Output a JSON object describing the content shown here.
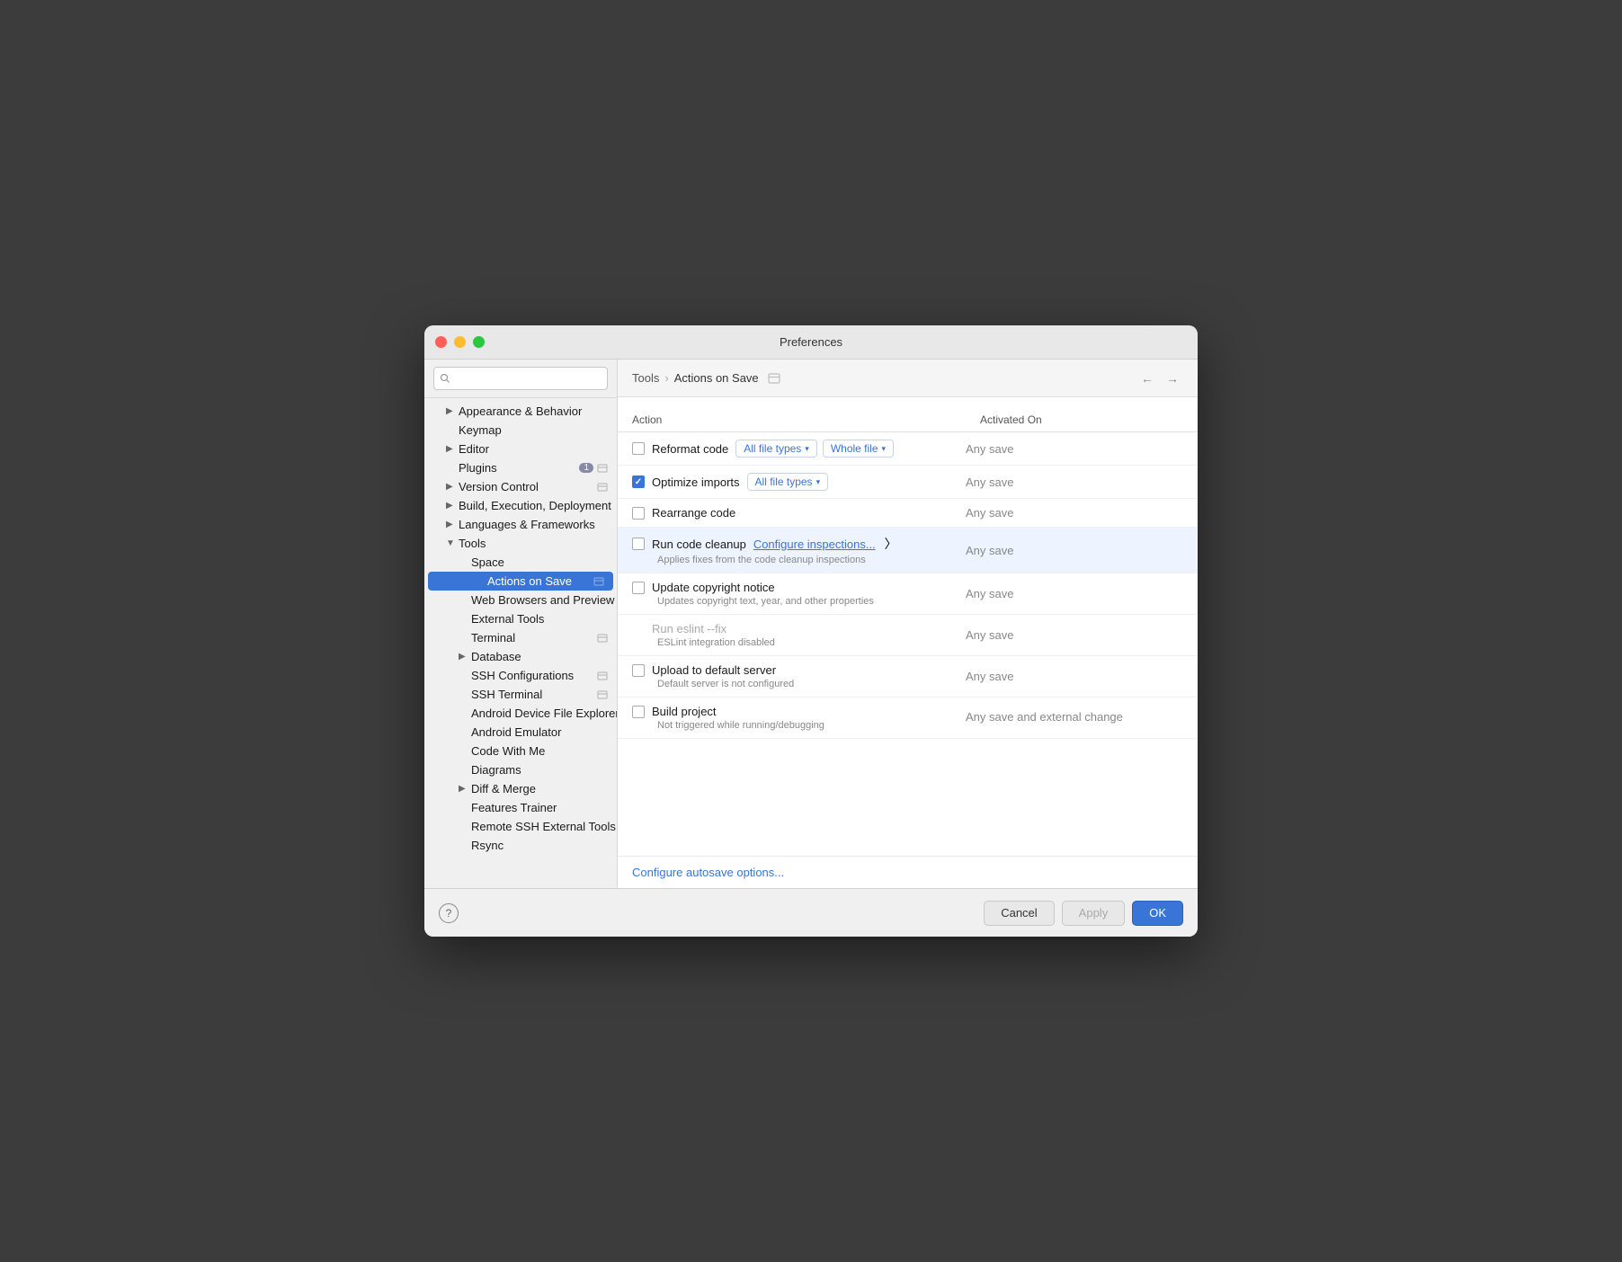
{
  "window": {
    "title": "Preferences"
  },
  "sidebar": {
    "search_placeholder": "",
    "items": [
      {
        "id": "appearance",
        "label": "Appearance & Behavior",
        "indent": 1,
        "expandable": true,
        "badge": null,
        "settings_icon": false
      },
      {
        "id": "keymap",
        "label": "Keymap",
        "indent": 1,
        "expandable": false,
        "badge": null,
        "settings_icon": false
      },
      {
        "id": "editor",
        "label": "Editor",
        "indent": 1,
        "expandable": true,
        "badge": null,
        "settings_icon": false
      },
      {
        "id": "plugins",
        "label": "Plugins",
        "indent": 1,
        "expandable": false,
        "badge": "1",
        "settings_icon": true
      },
      {
        "id": "version-control",
        "label": "Version Control",
        "indent": 1,
        "expandable": true,
        "badge": null,
        "settings_icon": true
      },
      {
        "id": "build",
        "label": "Build, Execution, Deployment",
        "indent": 1,
        "expandable": true,
        "badge": null,
        "settings_icon": false
      },
      {
        "id": "languages",
        "label": "Languages & Frameworks",
        "indent": 1,
        "expandable": true,
        "badge": null,
        "settings_icon": false
      },
      {
        "id": "tools",
        "label": "Tools",
        "indent": 1,
        "expandable": true,
        "active_parent": true
      },
      {
        "id": "space",
        "label": "Space",
        "indent": 2,
        "expandable": false
      },
      {
        "id": "actions-on-save",
        "label": "Actions on Save",
        "indent": 3,
        "expandable": false,
        "active": true,
        "settings_icon": true
      },
      {
        "id": "web-browsers",
        "label": "Web Browsers and Preview",
        "indent": 2,
        "expandable": false
      },
      {
        "id": "external-tools",
        "label": "External Tools",
        "indent": 2,
        "expandable": false
      },
      {
        "id": "terminal",
        "label": "Terminal",
        "indent": 2,
        "expandable": false,
        "settings_icon": true
      },
      {
        "id": "database",
        "label": "Database",
        "indent": 2,
        "expandable": true
      },
      {
        "id": "ssh-configurations",
        "label": "SSH Configurations",
        "indent": 2,
        "expandable": false,
        "settings_icon": true
      },
      {
        "id": "ssh-terminal",
        "label": "SSH Terminal",
        "indent": 2,
        "expandable": false,
        "settings_icon": true
      },
      {
        "id": "android-device",
        "label": "Android Device File Explorer",
        "indent": 2,
        "expandable": false
      },
      {
        "id": "android-emulator",
        "label": "Android Emulator",
        "indent": 2,
        "expandable": false
      },
      {
        "id": "code-with-me",
        "label": "Code With Me",
        "indent": 2,
        "expandable": false
      },
      {
        "id": "diagrams",
        "label": "Diagrams",
        "indent": 2,
        "expandable": false
      },
      {
        "id": "diff-merge",
        "label": "Diff & Merge",
        "indent": 2,
        "expandable": true
      },
      {
        "id": "features-trainer",
        "label": "Features Trainer",
        "indent": 2,
        "expandable": false
      },
      {
        "id": "remote-ssh",
        "label": "Remote SSH External Tools",
        "indent": 2,
        "expandable": false
      },
      {
        "id": "rsync",
        "label": "Rsync",
        "indent": 2,
        "expandable": false
      }
    ]
  },
  "breadcrumb": {
    "parent": "Tools",
    "current": "Actions on Save"
  },
  "table": {
    "headers": {
      "action": "Action",
      "activated_on": "Activated On"
    },
    "rows": [
      {
        "id": "reformat-code",
        "name": "Reformat code",
        "description": null,
        "checked": false,
        "dropdown1": "All file types",
        "dropdown2": "Whole file",
        "activated": "Any save",
        "configure_link": null,
        "highlighted": false,
        "disabled": false
      },
      {
        "id": "optimize-imports",
        "name": "Optimize imports",
        "description": null,
        "checked": true,
        "dropdown1": "All file types",
        "dropdown2": null,
        "activated": "Any save",
        "configure_link": null,
        "highlighted": false,
        "disabled": false
      },
      {
        "id": "rearrange-code",
        "name": "Rearrange code",
        "description": null,
        "checked": false,
        "dropdown1": null,
        "dropdown2": null,
        "activated": "Any save",
        "configure_link": null,
        "highlighted": false,
        "disabled": false
      },
      {
        "id": "run-code-cleanup",
        "name": "Run code cleanup",
        "description": "Applies fixes from the code cleanup inspections",
        "checked": false,
        "dropdown1": null,
        "dropdown2": null,
        "activated": "Any save",
        "configure_link": "Configure inspections...",
        "highlighted": true,
        "disabled": false
      },
      {
        "id": "update-copyright",
        "name": "Update copyright notice",
        "description": "Updates copyright text, year, and other properties",
        "checked": false,
        "dropdown1": null,
        "dropdown2": null,
        "activated": "Any save",
        "configure_link": null,
        "highlighted": false,
        "disabled": false
      },
      {
        "id": "run-eslint",
        "name": "Run eslint --fix",
        "description": "ESLint integration disabled",
        "checked": null,
        "dropdown1": null,
        "dropdown2": null,
        "activated": "Any save",
        "configure_link": null,
        "highlighted": false,
        "disabled": true,
        "no_checkbox": true
      },
      {
        "id": "upload-to-server",
        "name": "Upload to default server",
        "description": "Default server is not configured",
        "checked": false,
        "dropdown1": null,
        "dropdown2": null,
        "activated": "Any save",
        "configure_link": null,
        "highlighted": false,
        "disabled": false
      },
      {
        "id": "build-project",
        "name": "Build project",
        "description": "Not triggered while running/debugging",
        "checked": false,
        "dropdown1": null,
        "dropdown2": null,
        "activated": "Any save and external change",
        "configure_link": null,
        "highlighted": false,
        "disabled": false
      }
    ]
  },
  "footer": {
    "autosave_link": "Configure autosave options..."
  },
  "buttons": {
    "cancel": "Cancel",
    "apply": "Apply",
    "ok": "OK",
    "help": "?"
  }
}
